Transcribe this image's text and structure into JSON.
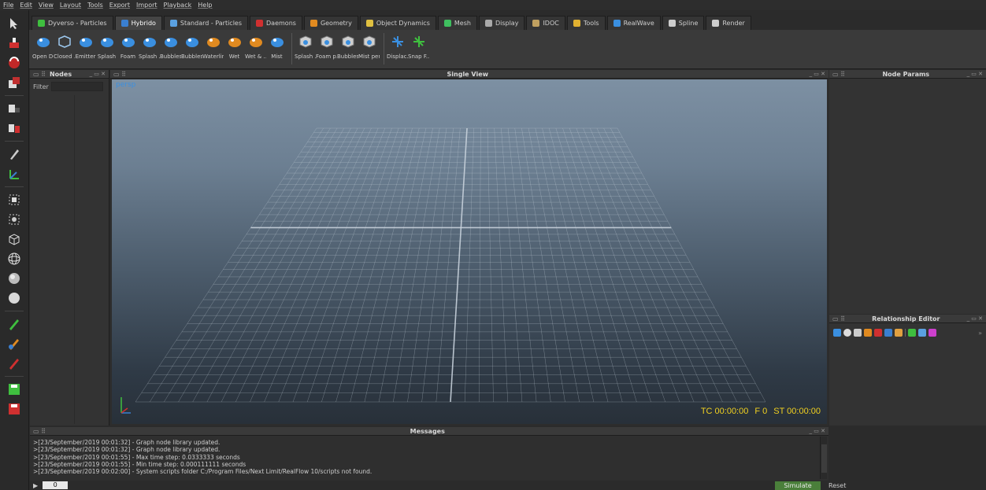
{
  "menu": [
    "File",
    "Edit",
    "View",
    "Layout",
    "Tools",
    "Export",
    "Import",
    "Playback",
    "Help"
  ],
  "tabs": [
    {
      "label": "Dyverso - Particles",
      "color": "#3fbf3f"
    },
    {
      "label": "Hybrido",
      "color": "#3a7fd0",
      "active": true
    },
    {
      "label": "Standard - Particles",
      "color": "#5aa0e0"
    },
    {
      "label": "Daemons",
      "color": "#d03030"
    },
    {
      "label": "Geometry",
      "color": "#e08a20"
    },
    {
      "label": "Object Dynamics",
      "color": "#e0c040"
    },
    {
      "label": "Mesh",
      "color": "#3fbf5f"
    },
    {
      "label": "Display",
      "color": "#aaaaaa"
    },
    {
      "label": "IDOC",
      "color": "#c0a060"
    },
    {
      "label": "Tools",
      "color": "#e0b030"
    },
    {
      "label": "RealWave",
      "color": "#3a8fe0"
    },
    {
      "label": "Spline",
      "color": "#cccccc"
    },
    {
      "label": "Render",
      "color": "#cccccc"
    }
  ],
  "shelf": [
    "Open D...",
    "Closed ...",
    "Emitter",
    "Splash",
    "Foam",
    "Splash ...",
    "Bubbles",
    "Bubbles...",
    "Waterline",
    "Wet",
    "Wet & ...",
    "Mist",
    "Splash ...",
    "Foam p...",
    "Bubbles...",
    "Mist per...",
    "Displac...",
    "Snap F..."
  ],
  "panels": {
    "nodes_title": "Nodes",
    "filter_label": "Filter",
    "viewport_title": "Single View",
    "viewport_mode": "persp",
    "node_params_title": "Node Params",
    "relationship_title": "Relationship Editor",
    "messages_title": "Messages"
  },
  "timecode": {
    "tc": "TC 00:00:00",
    "frame": "F 0",
    "st": "ST 00:00:00"
  },
  "messages": [
    ">[23/September/2019 00:01:32] - Graph node library updated.",
    ">[23/September/2019 00:01:32] - Graph node library updated.",
    ">[23/September/2019 00:01:55] - Max time step: 0.0333333 seconds",
    ">[23/September/2019 00:01:55] - Min time step: 0.000111111 seconds",
    ">[23/September/2019 00:02:00] - System scripts folder C:/Program Files/Next Limit/RealFlow 10/scripts not found."
  ],
  "timeline": {
    "current_frame": "0",
    "simulate_label": "Simulate",
    "reset_label": "Reset"
  }
}
